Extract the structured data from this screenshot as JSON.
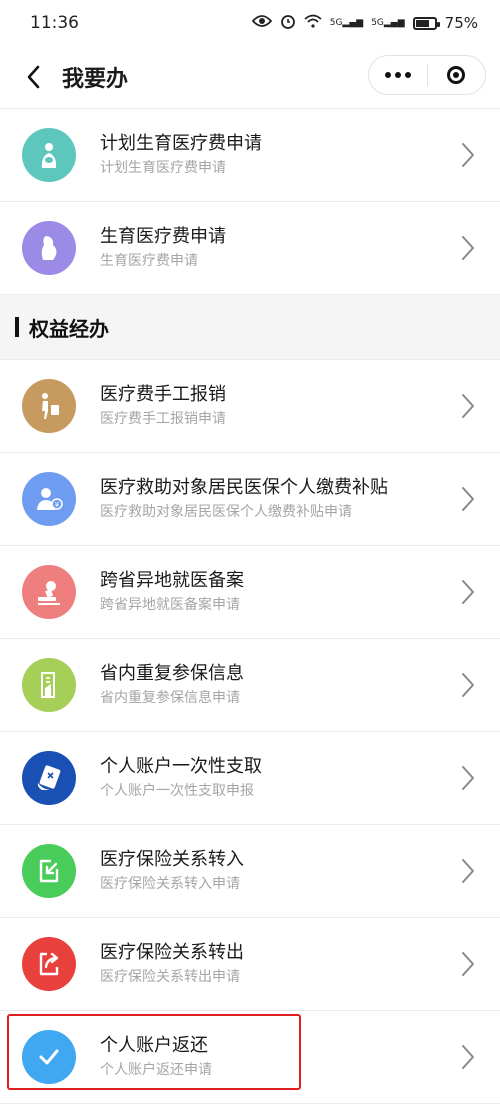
{
  "status": {
    "time": "11:36",
    "signal1": "5G",
    "signal2": "5G",
    "battery": "75%",
    "battery_level": 0.75
  },
  "nav": {
    "title": "我要办"
  },
  "top_items": [
    {
      "title": "计划生育医疗费申请",
      "sub": "计划生育医疗费申请",
      "color": "#5ec7bd",
      "icon": "mother-baby-icon"
    },
    {
      "title": "生育医疗费申请",
      "sub": "生育医疗费申请",
      "color": "#9b8ae6",
      "icon": "pregnant-icon"
    }
  ],
  "section": {
    "title": "权益经办"
  },
  "items": [
    {
      "title": "医疗费手工报销",
      "sub": "医疗费手工报销申请",
      "color": "#c79a5f",
      "icon": "traveler-icon"
    },
    {
      "title": "医疗救助对象居民医保个人缴费补贴",
      "sub": "医疗救助对象居民医保个人缴费补贴申请",
      "color": "#6d9cf1",
      "icon": "user-yuan-icon"
    },
    {
      "title": "跨省异地就医备案",
      "sub": "跨省异地就医备案申请",
      "color": "#ef7f7f",
      "icon": "stamp-icon"
    },
    {
      "title": "省内重复参保信息",
      "sub": "省内重复参保信息申请",
      "color": "#a6cf58",
      "icon": "document-icon"
    },
    {
      "title": "个人账户一次性支取",
      "sub": "个人账户一次性支取申报",
      "color": "#1a4fb4",
      "icon": "card-hand-icon"
    },
    {
      "title": "医疗保险关系转入",
      "sub": "医疗保险关系转入申请",
      "color": "#49cc5a",
      "icon": "transfer-in-icon"
    },
    {
      "title": "医疗保险关系转出",
      "sub": "医疗保险关系转出申请",
      "color": "#e8403d",
      "icon": "transfer-out-icon"
    },
    {
      "title": "个人账户返还",
      "sub": "个人账户返还申请",
      "color": "#3fa8f0",
      "icon": "check-icon"
    }
  ]
}
